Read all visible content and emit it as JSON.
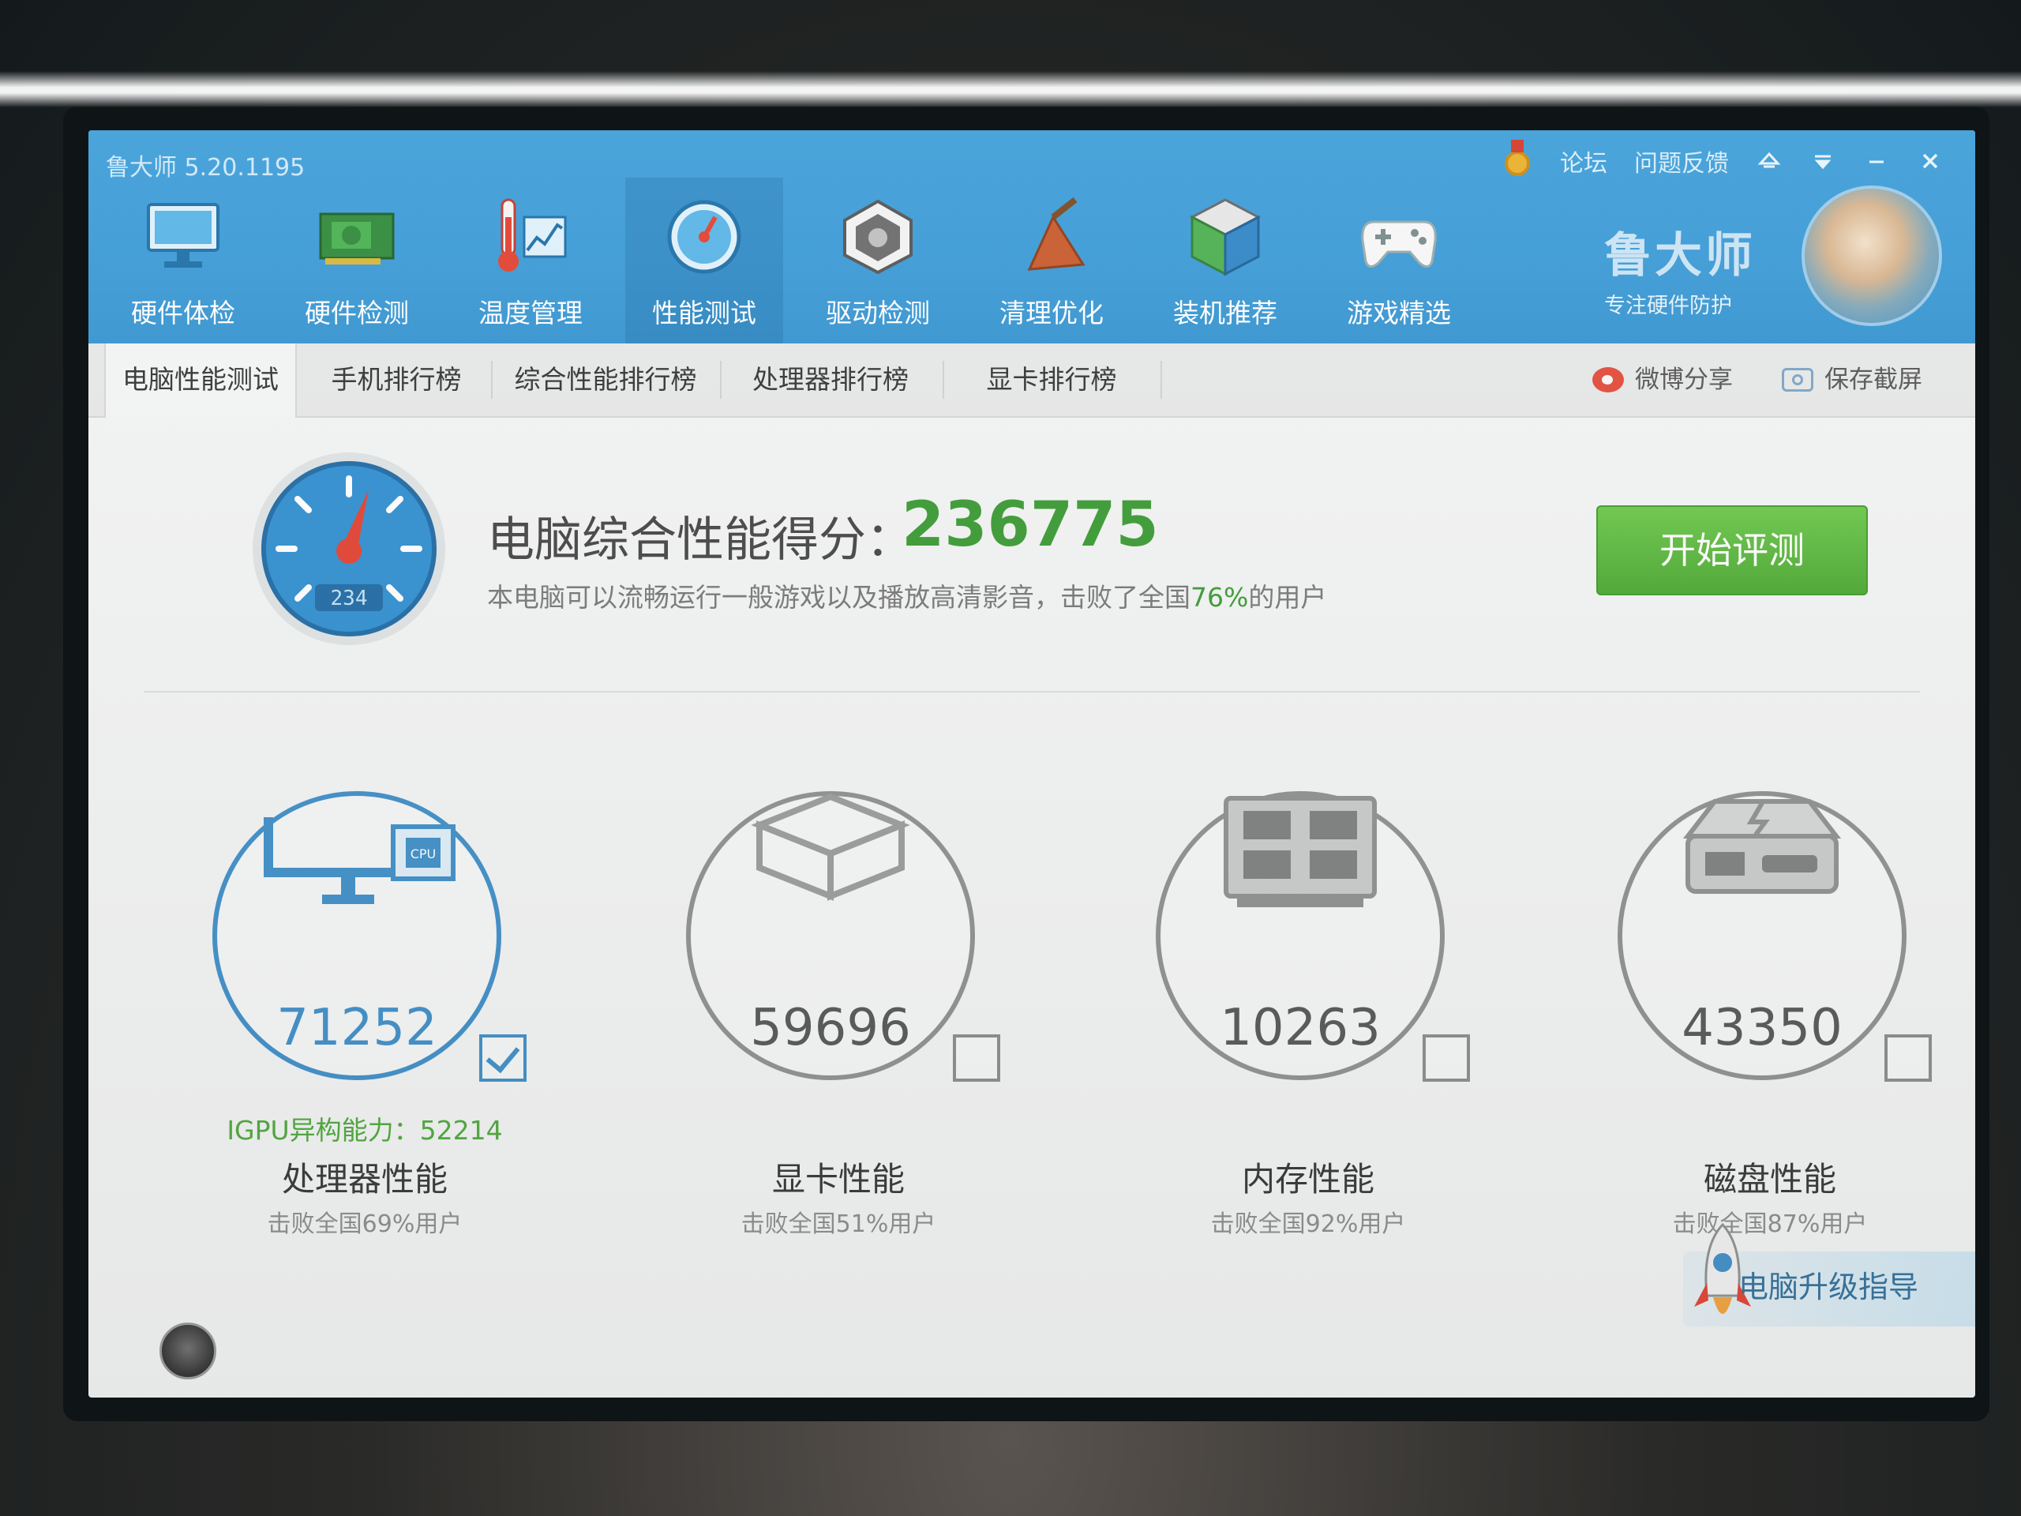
{
  "window": {
    "title": "鲁大师 5.20.1195",
    "links": [
      "论坛",
      "问题反馈"
    ]
  },
  "toolbar": [
    {
      "label": "硬件体检",
      "icon": "monitor-icon"
    },
    {
      "label": "硬件检测",
      "icon": "graphics-card-icon"
    },
    {
      "label": "温度管理",
      "icon": "thermometer-icon"
    },
    {
      "label": "性能测试",
      "icon": "speedometer-icon",
      "active": true
    },
    {
      "label": "驱动检测",
      "icon": "driver-chip-icon"
    },
    {
      "label": "清理优化",
      "icon": "broom-icon"
    },
    {
      "label": "装机推荐",
      "icon": "cube-icon"
    },
    {
      "label": "游戏精选",
      "icon": "gamepad-icon"
    }
  ],
  "brand": {
    "name": "鲁大师",
    "slogan": "专注硬件防护"
  },
  "tabs": [
    {
      "label": "电脑性能测试",
      "active": true
    },
    {
      "label": "手机排行榜"
    },
    {
      "label": "综合性能排行榜"
    },
    {
      "label": "处理器排行榜"
    },
    {
      "label": "显卡排行榜"
    }
  ],
  "tab_tools": {
    "share": "微博分享",
    "screenshot": "保存截屏"
  },
  "summary": {
    "label": "电脑综合性能得分：",
    "score": "236775",
    "sub_prefix": "本电脑可以流畅运行一般游戏以及播放高清影音，击败了全国",
    "sub_pct": "76%",
    "sub_suffix": "的用户",
    "gauge_readout": "234",
    "start_button": "开始评测"
  },
  "metrics": [
    {
      "score": "71252",
      "title": "处理器性能",
      "sub": "击败全国69%用户",
      "extra": "IGPU异构能力：52214",
      "checked": true,
      "icon": "cpu-monitor-icon"
    },
    {
      "score": "59696",
      "title": "显卡性能",
      "sub": "击败全国51%用户",
      "checked": false,
      "icon": "gpu-cube-icon"
    },
    {
      "score": "10263",
      "title": "内存性能",
      "sub": "击败全国92%用户",
      "checked": false,
      "icon": "memory-chip-icon"
    },
    {
      "score": "43350",
      "title": "磁盘性能",
      "sub": "击败全国87%用户",
      "checked": false,
      "icon": "disk-drive-icon"
    }
  ],
  "upgrade_guide": "电脑升级指导",
  "colors": {
    "header_blue": "#3b9ad6",
    "score_green": "#3a9a32",
    "active_ring": "#3d8ec8",
    "start_green": "#5bb83c"
  }
}
